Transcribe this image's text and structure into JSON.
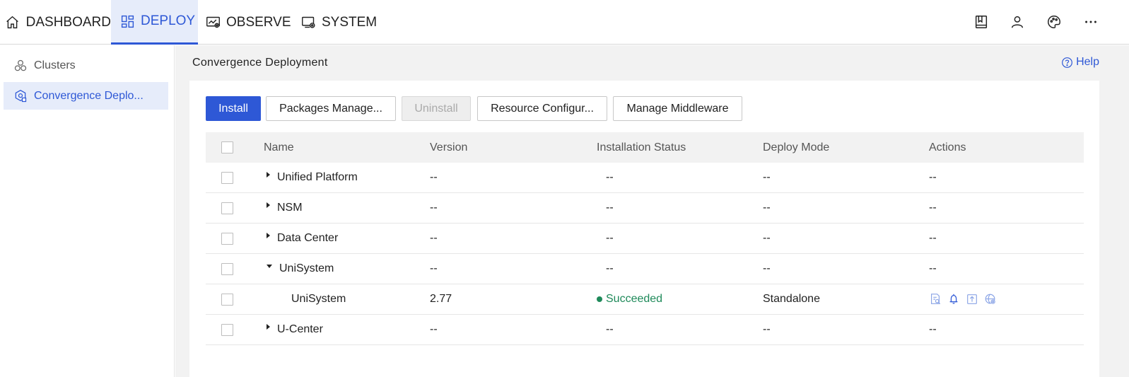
{
  "topnav": {
    "tabs": [
      {
        "label": "DASHBOARD",
        "icon": "home-icon"
      },
      {
        "label": "DEPLOY",
        "icon": "grid-icon",
        "active": true
      },
      {
        "label": "OBSERVE",
        "icon": "monitor-chart-icon"
      },
      {
        "label": "SYSTEM",
        "icon": "computer-gear-icon"
      }
    ],
    "right_icons": [
      "book-icon",
      "user-icon",
      "palette-icon",
      "more-icon"
    ]
  },
  "sidebar": {
    "items": [
      {
        "label": "Clusters",
        "icon": "clusters-icon"
      },
      {
        "label": "Convergence Deplo...",
        "icon": "deploy-gear-icon",
        "active": true
      }
    ]
  },
  "main": {
    "title": "Convergence Deployment",
    "help_label": "Help",
    "buttons": {
      "install": "Install",
      "packages": "Packages Manage...",
      "uninstall": "Uninstall",
      "resource": "Resource Configur...",
      "middleware": "Manage Middleware"
    },
    "table": {
      "columns": [
        "Name",
        "Version",
        "Installation Status",
        "Deploy Mode",
        "Actions"
      ],
      "rows": [
        {
          "name": "Unified Platform",
          "version": "--",
          "status": "--",
          "mode": "--",
          "actions": "--",
          "caret": "right"
        },
        {
          "name": "NSM",
          "version": "--",
          "status": "--",
          "mode": "--",
          "actions": "--",
          "caret": "right"
        },
        {
          "name": "Data Center",
          "version": "--",
          "status": "--",
          "mode": "--",
          "actions": "--",
          "caret": "right"
        },
        {
          "name": "UniSystem",
          "version": "--",
          "status": "--",
          "mode": "--",
          "actions": "--",
          "caret": "down"
        },
        {
          "name": "UniSystem",
          "version": "2.77",
          "status": "Succeeded",
          "mode": "Standalone",
          "child": true,
          "action_icons": [
            "log-search-icon",
            "alert-bell-icon",
            "upgrade-icon",
            "settings-globe-icon"
          ]
        },
        {
          "name": "U-Center",
          "version": "--",
          "status": "--",
          "mode": "--",
          "actions": "--",
          "caret": "right"
        }
      ]
    }
  },
  "colors": {
    "accent": "#2e58d6",
    "success": "#1f8a5a",
    "active_bg": "#e6ecfa"
  }
}
